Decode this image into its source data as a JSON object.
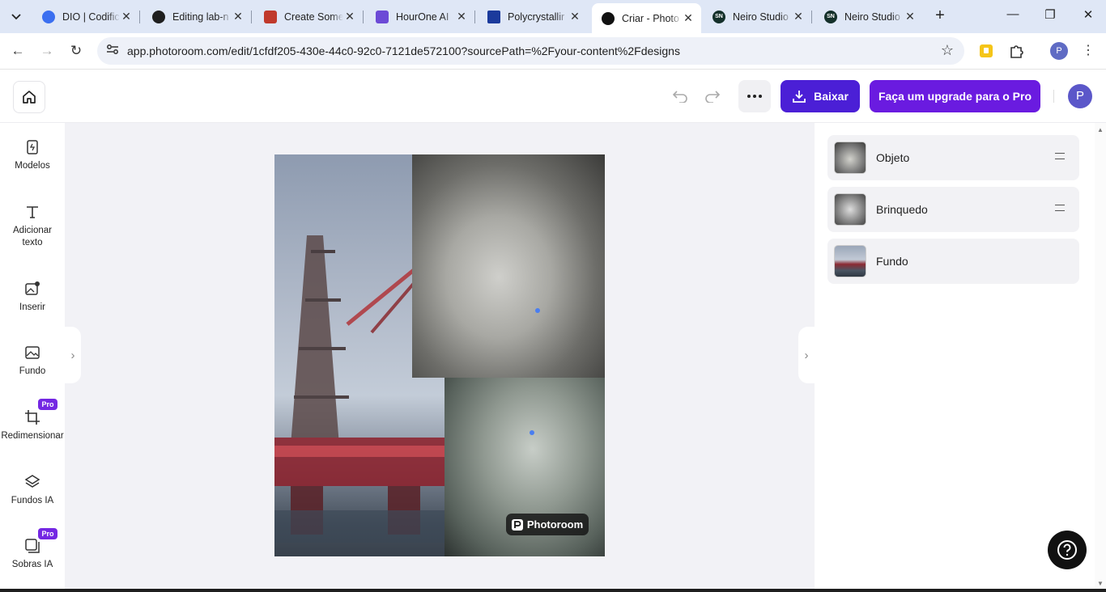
{
  "browser": {
    "tabs": [
      {
        "title": "DIO | Codific",
        "favicon_color": "#3b6ff0"
      },
      {
        "title": "Editing lab-n",
        "favicon_color": "#1f1f1f"
      },
      {
        "title": "Create Some",
        "favicon_color": "#c0392b"
      },
      {
        "title": "HourOne AI",
        "favicon_color": "#6c4ad6"
      },
      {
        "title": "Polycrystallir",
        "favicon_color": "#1b3a9c"
      },
      {
        "title": "Criar - Photo",
        "favicon_color": "#111111"
      },
      {
        "title": "Neiro Studio",
        "favicon_color": "#14302a"
      },
      {
        "title": "Neiro Studio",
        "favicon_color": "#14302a"
      }
    ],
    "tab_favicon_texts": {
      "neiro": "SN"
    },
    "url_host": "app.photoroom.com",
    "url_path": "/edit/1cfdf205-430e-44c0-92c0-7121de572100?sourcePath=%2Fyour-content%2Fdesigns",
    "profile_initial": "P"
  },
  "header": {
    "download_label": "Baixar",
    "upgrade_label": "Faça um upgrade para o Pro",
    "user_initial": "P"
  },
  "sidebar": {
    "items": [
      {
        "label": "Modelos",
        "icon": "templates-icon"
      },
      {
        "label": "Adicionar texto",
        "icon": "text-icon"
      },
      {
        "label": "Inserir",
        "icon": "insert-image-icon"
      },
      {
        "label": "Fundo",
        "icon": "background-icon"
      },
      {
        "label": "Redimensionar",
        "icon": "crop-icon",
        "badge": "Pro"
      },
      {
        "label": "Fundos IA",
        "icon": "layers-icon"
      },
      {
        "label": "Sobras IA",
        "icon": "shadow-icon",
        "badge": "Pro"
      }
    ]
  },
  "canvas": {
    "watermark": "Photoroom"
  },
  "layers": [
    {
      "name": "Objeto"
    },
    {
      "name": "Brinquedo"
    },
    {
      "name": "Fundo"
    }
  ],
  "colors": {
    "primary": "#4b1fd6",
    "upgrade": "#6a1be0",
    "pro_badge": "#7427e3",
    "canvas_bg": "#f2f2f6"
  }
}
